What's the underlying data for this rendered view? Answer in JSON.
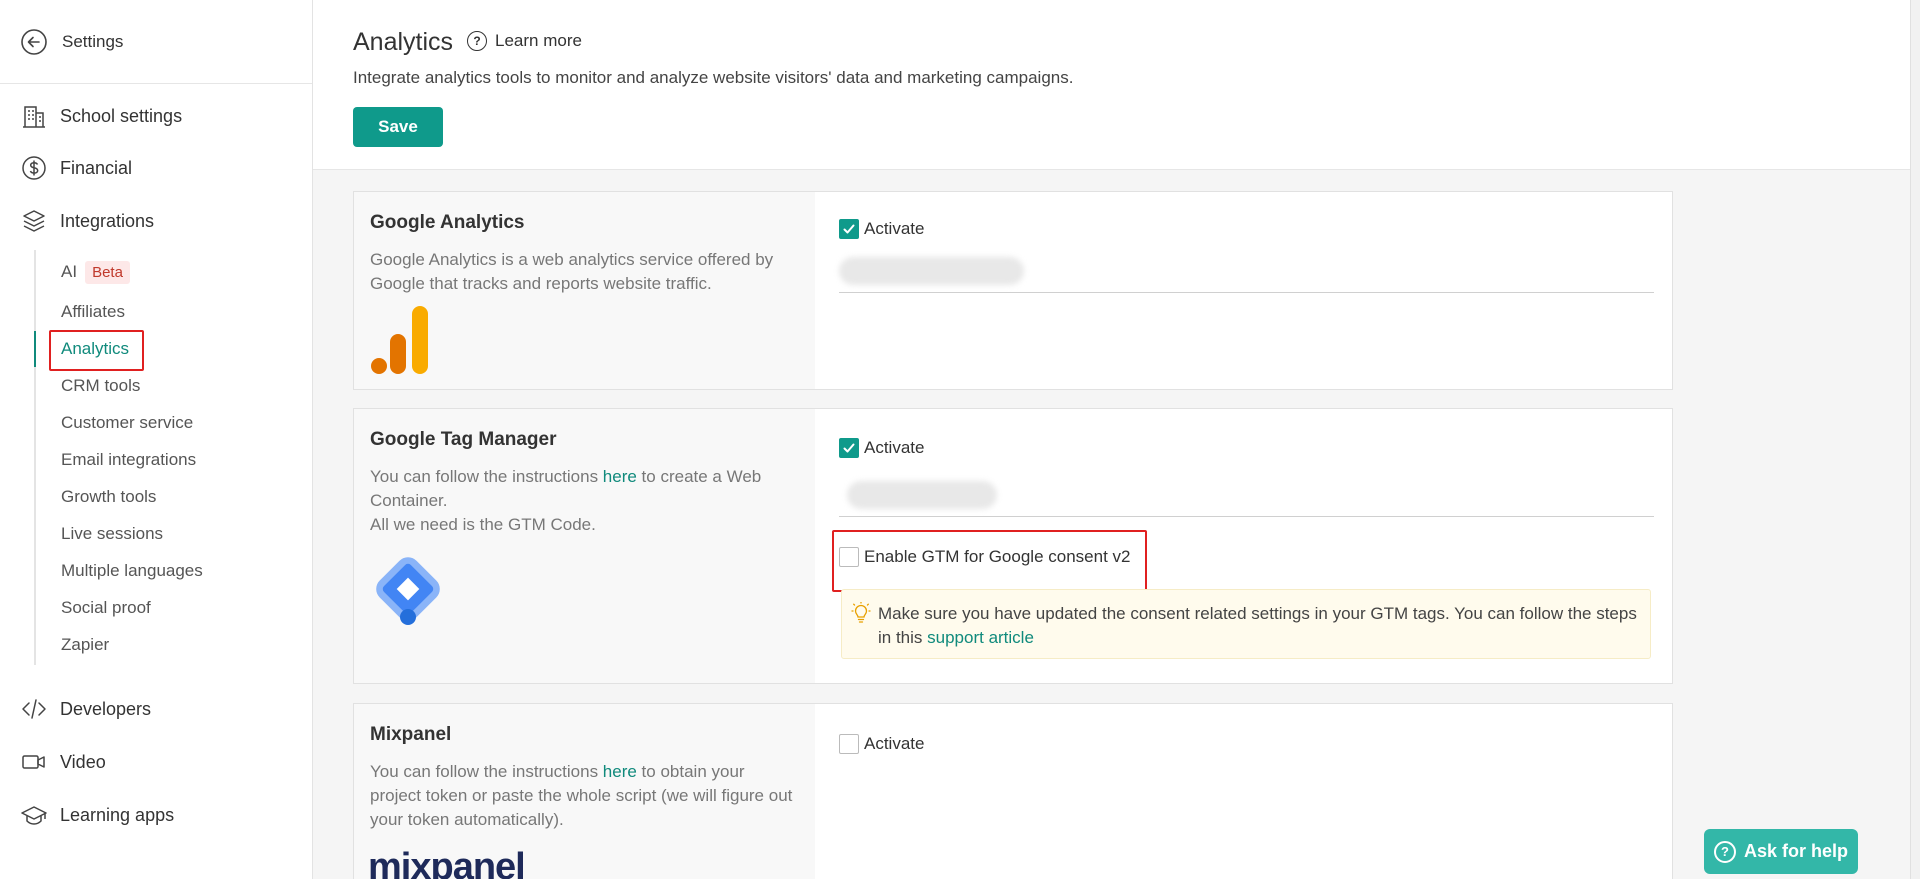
{
  "sidebar": {
    "back_label": "Settings",
    "items": [
      {
        "label": "School settings",
        "icon": "building-icon"
      },
      {
        "label": "Financial",
        "icon": "dollar-icon"
      },
      {
        "label": "Integrations",
        "icon": "layers-icon"
      },
      {
        "label": "Developers",
        "icon": "code-icon"
      },
      {
        "label": "Video",
        "icon": "video-icon"
      },
      {
        "label": "Learning apps",
        "icon": "graduation-cap-icon"
      }
    ],
    "sub_items": [
      {
        "label": "AI",
        "badge": "Beta"
      },
      {
        "label": "Affiliates"
      },
      {
        "label": "Analytics",
        "active": true
      },
      {
        "label": "CRM tools"
      },
      {
        "label": "Customer service"
      },
      {
        "label": "Email integrations"
      },
      {
        "label": "Growth tools"
      },
      {
        "label": "Live sessions"
      },
      {
        "label": "Multiple languages"
      },
      {
        "label": "Social proof"
      },
      {
        "label": "Zapier"
      }
    ]
  },
  "header": {
    "title": "Analytics",
    "learn_more": "Learn more",
    "description": "Integrate analytics tools to monitor and analyze website visitors' data and marketing campaigns.",
    "save_label": "Save"
  },
  "cards": [
    {
      "name": "Google Analytics",
      "description": "Google Analytics is a web analytics service offered by Google that tracks and reports website traffic.",
      "activate_label": "Activate",
      "activated": true
    },
    {
      "name": "Google Tag Manager",
      "desc_pre": "You can follow the instructions ",
      "desc_link": "here",
      "desc_post": " to create a Web Container.",
      "desc_line2": "All we need is the GTM Code.",
      "activate_label": "Activate",
      "activated": true,
      "consent_label": "Enable GTM for Google consent v2",
      "consent_checked": false,
      "note_pre": "Make sure you have updated the consent related settings in your GTM tags. You can follow the steps in this ",
      "note_link": "support article"
    },
    {
      "name": "Mixpanel",
      "desc_pre": "You can follow the instructions ",
      "desc_link": "here",
      "desc_post": " to obtain your project token or paste the whole script (we will figure out your token automatically).",
      "activate_label": "Activate",
      "activated": false,
      "logo_text": "mixpanel"
    }
  ],
  "help_button": "Ask for help",
  "colors": {
    "accent": "#0f9a8b",
    "accent_text": "#108a7c",
    "help_bg": "#33b7a8",
    "highlight_red": "#e02020",
    "beta_bg": "#fde8e8"
  }
}
